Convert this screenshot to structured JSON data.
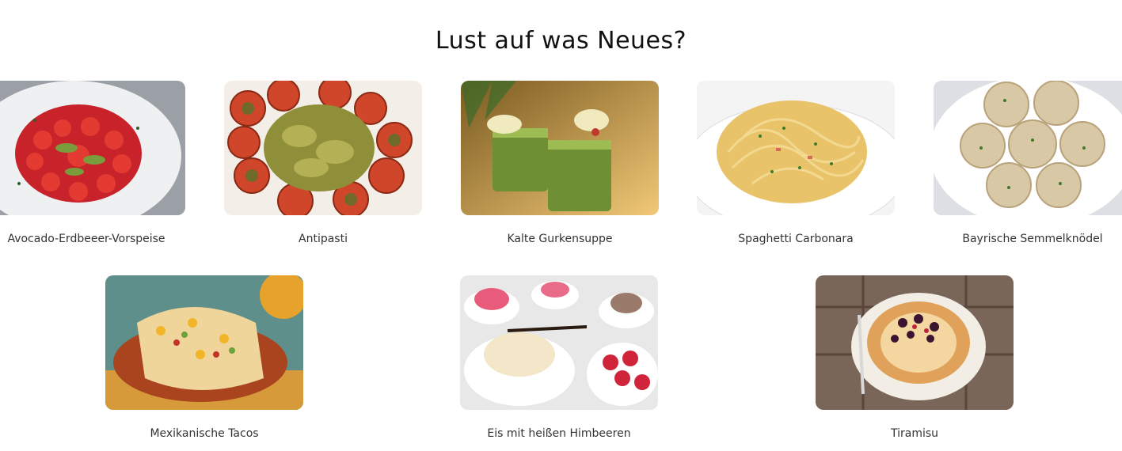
{
  "page": {
    "title": "Lust auf was Neues?"
  },
  "recipes": [
    {
      "name": "Avocado-Erdbeeer-Vorspeise",
      "image": "strawberry-avocado-salad-image"
    },
    {
      "name": "Antipasti",
      "image": "antipasti-image"
    },
    {
      "name": "Kalte Gurkensuppe",
      "image": "cold-cucumber-soup-image"
    },
    {
      "name": "Spaghetti Carbonara",
      "image": "spaghetti-carbonara-image"
    },
    {
      "name": "Bayrische Semmelknödel",
      "image": "bread-dumplings-image"
    },
    {
      "name": "Mexikanische Tacos",
      "image": "tacos-image"
    },
    {
      "name": "Eis mit heißen Himbeeren",
      "image": "ice-cream-raspberries-image"
    },
    {
      "name": "Tiramisu",
      "image": "tiramisu-image"
    }
  ]
}
